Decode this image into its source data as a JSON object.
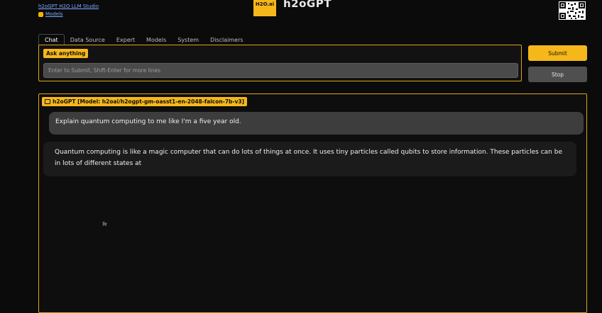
{
  "header": {
    "link1": "h2oGPT H2O LLM Studio",
    "link2": "Models",
    "logo_text": "H2O.ai",
    "app_title": "h2oGPT"
  },
  "tabs": [
    {
      "label": "Chat",
      "active": true
    },
    {
      "label": "Data Source"
    },
    {
      "label": "Expert"
    },
    {
      "label": "Models"
    },
    {
      "label": "System"
    },
    {
      "label": "Disclaimers"
    }
  ],
  "input": {
    "badge": "Ask anything",
    "placeholder": "Enter to Submit, Shift-Enter for more lines",
    "value": ""
  },
  "buttons": {
    "submit": "Submit",
    "stop": "Stop"
  },
  "chat": {
    "label": "h2oGPT [Model: h2oai/h2ogpt-gm-oasst1-en-2048-falcon-7b-v3]",
    "messages": [
      {
        "role": "user",
        "text": "Explain quantum computing to me like I'm a five year old."
      },
      {
        "role": "bot",
        "text": "Quantum computing is like a magic computer that can do lots of things at once. It uses tiny particles called qubits to store information. These particles can be in lots of different states at"
      }
    ]
  },
  "colors": {
    "accent": "#f6b71b",
    "background": "#0b0b0c",
    "link": "#7da7ff"
  }
}
